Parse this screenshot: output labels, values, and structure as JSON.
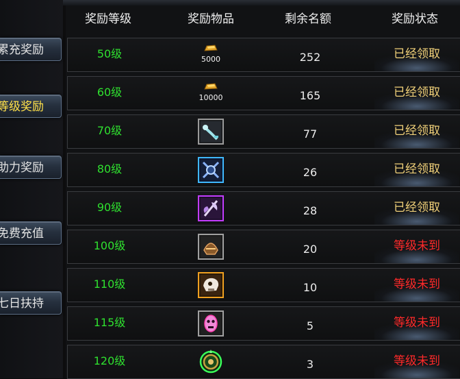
{
  "sidebar": {
    "items": [
      {
        "label": "累充奖励",
        "active": false
      },
      {
        "label": "等级奖励",
        "active": true
      },
      {
        "label": "助力奖励",
        "active": false
      },
      {
        "label": "免费充值",
        "active": false
      },
      {
        "label": "七日扶持",
        "active": false
      }
    ]
  },
  "table": {
    "headers": [
      "奖励等级",
      "奖励物品",
      "剩余名额",
      "奖励状态"
    ],
    "rows": [
      {
        "level": "50级",
        "item_icon": "gold-ingot-icon",
        "item_amount": "5000",
        "remaining": "252",
        "status": "已经领取",
        "state": "claimed"
      },
      {
        "level": "60级",
        "item_icon": "gold-ingot-icon",
        "item_amount": "10000",
        "remaining": "165",
        "status": "已经领取",
        "state": "claimed"
      },
      {
        "level": "70级",
        "item_icon": "key-icon",
        "remaining": "77",
        "status": "已经领取",
        "state": "claimed"
      },
      {
        "level": "80级",
        "item_icon": "blue-armor-icon",
        "remaining": "26",
        "status": "已经领取",
        "state": "claimed"
      },
      {
        "level": "90级",
        "item_icon": "purple-axe-icon",
        "remaining": "28",
        "status": "已经领取",
        "state": "claimed"
      },
      {
        "level": "100级",
        "item_icon": "bronze-helmet-icon",
        "remaining": "20",
        "status": "等级未到",
        "state": "locked"
      },
      {
        "level": "110级",
        "item_icon": "skull-icon",
        "remaining": "10",
        "status": "等级未到",
        "state": "locked"
      },
      {
        "level": "115级",
        "item_icon": "mask-icon",
        "remaining": "5",
        "status": "等级未到",
        "state": "locked"
      },
      {
        "level": "120级",
        "item_icon": "green-ring-icon",
        "remaining": "3",
        "status": "等级未到",
        "state": "locked"
      }
    ]
  },
  "colors": {
    "level_text": "#2fe02f",
    "claimed": "#f2d27a",
    "locked": "#ff2a2a",
    "active_tab": "#ffe14a"
  }
}
